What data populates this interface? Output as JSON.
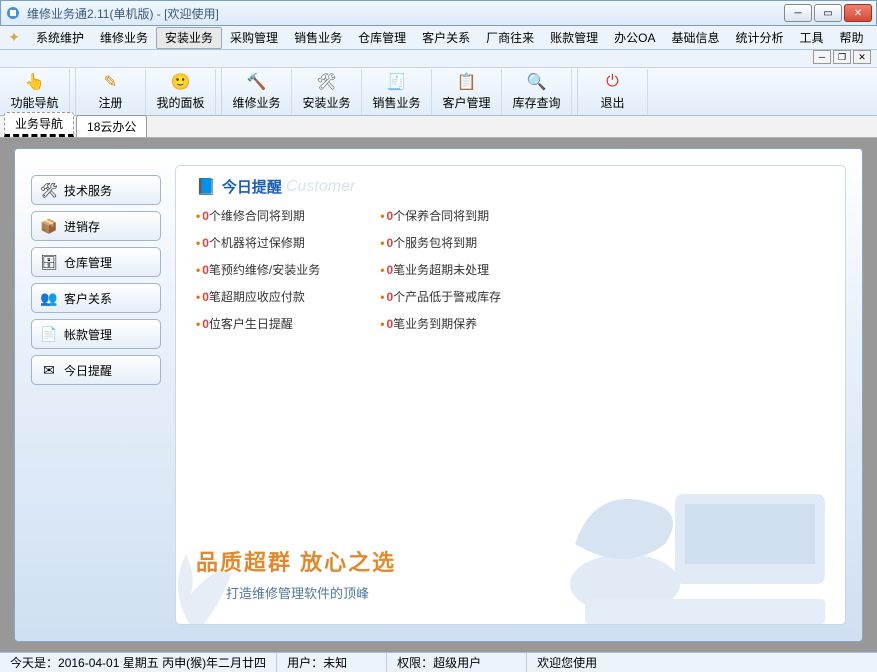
{
  "window": {
    "title": "维修业务通2.11(单机版) - [欢迎使用]"
  },
  "menu": {
    "items": [
      "系统维护",
      "维修业务",
      "安装业务",
      "采购管理",
      "销售业务",
      "仓库管理",
      "客户关系",
      "厂商往来",
      "账款管理",
      "办公OA",
      "基础信息",
      "统计分析",
      "工具",
      "帮助"
    ],
    "activeIndex": 2
  },
  "toolbar": {
    "buttons": [
      {
        "label": "功能导航",
        "icon": "👆",
        "color": "#e6a23c"
      },
      {
        "label": "注册",
        "icon": "✎",
        "color": "#d48806"
      },
      {
        "label": "我的面板",
        "icon": "🙂",
        "color": "#e6a23c"
      },
      {
        "label": "维修业务",
        "icon": "🔨",
        "color": "#6b6b6b"
      },
      {
        "label": "安装业务",
        "icon": "🛠",
        "color": "#6b6b6b"
      },
      {
        "label": "销售业务",
        "icon": "🧾",
        "color": "#6b6b6b"
      },
      {
        "label": "客户管理",
        "icon": "📋",
        "color": "#1a73e8"
      },
      {
        "label": "库存查询",
        "icon": "🔍",
        "color": "#1a73e8"
      },
      {
        "label": "退出",
        "icon": "⏻",
        "color": "#d93025"
      }
    ]
  },
  "tabs": {
    "items": [
      {
        "label": "业务导航",
        "active": true
      },
      {
        "label": "18云办公",
        "active": false
      }
    ]
  },
  "sidenav": {
    "items": [
      {
        "label": "技术服务",
        "icon": "🛠"
      },
      {
        "label": "进销存",
        "icon": "📦"
      },
      {
        "label": "仓库管理",
        "icon": "🗄"
      },
      {
        "label": "客户关系",
        "icon": "👥"
      },
      {
        "label": "帐款管理",
        "icon": "📄"
      },
      {
        "label": "今日提醒",
        "icon": "✉"
      }
    ]
  },
  "panel": {
    "title": "今日提醒",
    "ghost": "Customer",
    "left": [
      {
        "count": "0",
        "text": "个维修合同将到期"
      },
      {
        "count": "0",
        "text": "个机器将过保修期"
      },
      {
        "count": "0",
        "text": "笔预约维修/安装业务"
      },
      {
        "count": "0",
        "text": "笔超期应收应付款"
      },
      {
        "count": "0",
        "text": "位客户生日提醒"
      }
    ],
    "right": [
      {
        "count": "0",
        "text": "个保养合同将到期"
      },
      {
        "count": "0",
        "text": "个服务包将到期"
      },
      {
        "count": "0",
        "text": "笔业务超期未处理"
      },
      {
        "count": "0",
        "text": "个产品低于警戒库存"
      },
      {
        "count": "0",
        "text": "笔业务到期保养"
      }
    ]
  },
  "slogan": {
    "main": "品质超群  放心之选",
    "sub": "打造维修管理软件的顶峰"
  },
  "status": {
    "dateLabel": "今天是：",
    "date": "2016-04-01 星期五 丙申(猴)年二月廿四",
    "userLabel": "用户：",
    "user": "未知",
    "permLabel": "权限：",
    "perm": "超级用户",
    "welcome": "欢迎您使用"
  }
}
